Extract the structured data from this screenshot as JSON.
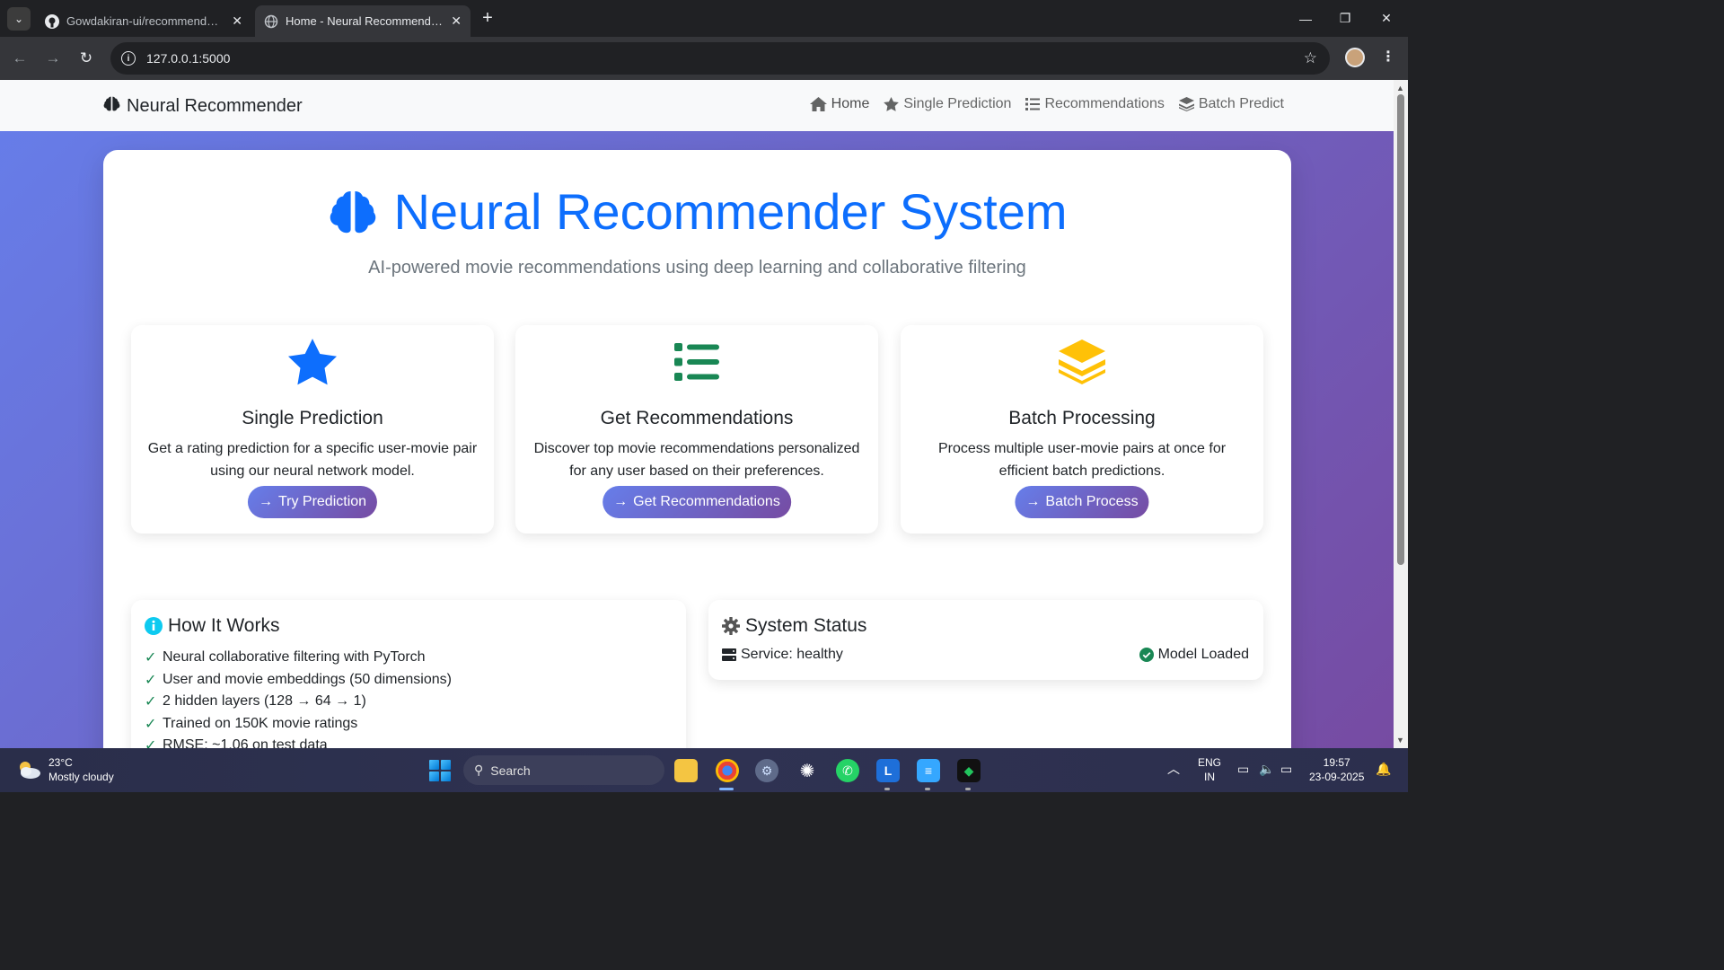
{
  "browser": {
    "tabs": [
      {
        "title": "Gowdakiran-ui/recommendatio",
        "favicon": "github-icon"
      },
      {
        "title": "Home - Neural Recommender S",
        "favicon": "globe-icon"
      }
    ],
    "url": "127.0.0.1:5000"
  },
  "navbar": {
    "brand": "Neural Recommender",
    "links": [
      "Home",
      "Single Prediction",
      "Recommendations",
      "Batch Predict"
    ]
  },
  "hero": {
    "title": "Neural Recommender System",
    "subtitle": "AI-powered movie recommendations using deep learning and collaborative filtering"
  },
  "features": [
    {
      "title": "Single Prediction",
      "desc": "Get a rating prediction for a specific user-movie pair using our neural network model.",
      "button": "Try Prediction",
      "icon": "star-icon",
      "color": "#0d6efd"
    },
    {
      "title": "Get Recommendations",
      "desc": "Discover top movie recommendations personalized for any user based on their preferences.",
      "button": "Get Recommendations",
      "icon": "list-icon",
      "color": "#198754"
    },
    {
      "title": "Batch Processing",
      "desc": "Process multiple user-movie pairs at once for efficient batch predictions.",
      "button": "Batch Process",
      "icon": "layers-icon",
      "color": "#ffc107"
    }
  ],
  "how_it_works": {
    "title": "How It Works",
    "items": [
      "Neural collaborative filtering with PyTorch",
      "User and movie embeddings (50 dimensions)",
      "2 hidden layers (128 → 64 → 1)",
      "Trained on 150K movie ratings",
      "RMSE: ~1.06 on test data"
    ]
  },
  "system_status": {
    "title": "System Status",
    "service": "Service: healthy",
    "model": "Model Loaded"
  },
  "taskbar": {
    "temperature": "23°C",
    "weather": "Mostly cloudy",
    "search": "Search",
    "lang1": "ENG",
    "lang2": "IN",
    "time": "19:57",
    "date": "23-09-2025"
  }
}
